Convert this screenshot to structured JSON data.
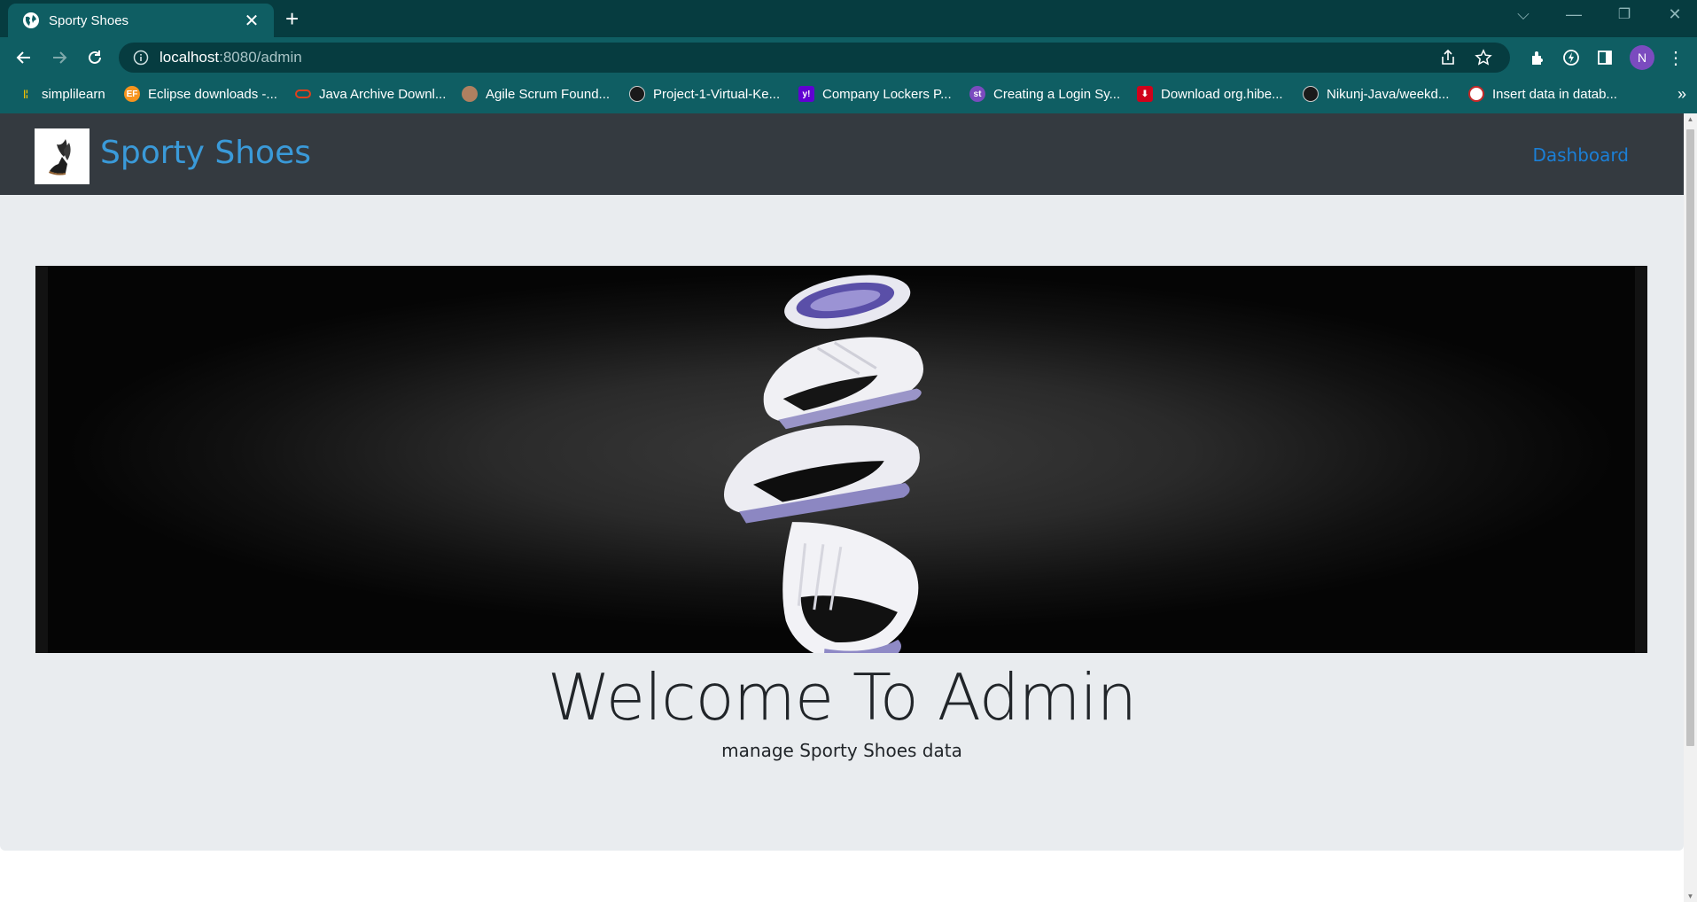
{
  "browser": {
    "tab_title": "Sporty Shoes",
    "new_tab_icon": "plus-icon",
    "url_host": "localhost",
    "url_rest": ":8080/admin",
    "profile_initial": "N",
    "accent": "#0f5e63",
    "frame": "#063c40"
  },
  "bookmarks": [
    {
      "label": "simplilearn",
      "icon": "simplilearn-icon",
      "color": "#f2c200"
    },
    {
      "label": "Eclipse downloads -...",
      "icon": "eclipse-icon",
      "color": "#f7941e"
    },
    {
      "label": "Java Archive Downl...",
      "icon": "oracle-icon",
      "color": "#e0401c"
    },
    {
      "label": "Agile Scrum Found...",
      "icon": "agile-icon",
      "color": "#b08060"
    },
    {
      "label": "Project-1-Virtual-Ke...",
      "icon": "github-icon",
      "color": "#222222"
    },
    {
      "label": "Company Lockers P...",
      "icon": "yahoo-icon",
      "color": "#6001d2"
    },
    {
      "label": "Creating a Login Sy...",
      "icon": "st-icon",
      "color": "#7b4bbf"
    },
    {
      "label": "Download org.hibe...",
      "icon": "download-icon",
      "color": "#d0021b"
    },
    {
      "label": "Nikunj-Java/weekd...",
      "icon": "github-icon",
      "color": "#222222"
    },
    {
      "label": "Insert data in datab...",
      "icon": "javatpoint-icon",
      "color": "#c62828"
    }
  ],
  "site": {
    "brand": "Sporty Shoes",
    "nav_link": "Dashboard",
    "brand_color": "#3a9ad9",
    "link_color": "#1b7fd6",
    "navbar_color": "#343a40"
  },
  "jumbotron": {
    "heading": "Welcome To Admin",
    "lead": "manage Sporty Shoes data",
    "background": "#e9ecef"
  }
}
